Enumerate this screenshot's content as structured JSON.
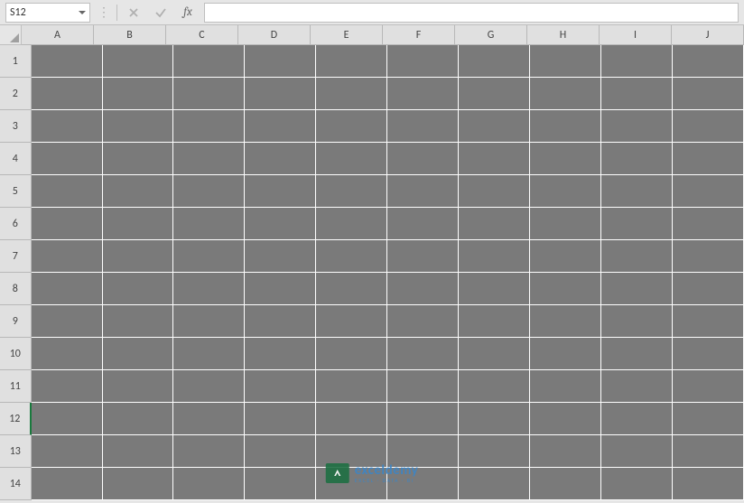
{
  "nameBox": {
    "value": "S12"
  },
  "formulaBar": {
    "value": ""
  },
  "columns": [
    "A",
    "B",
    "C",
    "D",
    "E",
    "F",
    "G",
    "H",
    "I",
    "J"
  ],
  "rows": [
    "1",
    "2",
    "3",
    "4",
    "5",
    "6",
    "7",
    "8",
    "9",
    "10",
    "11",
    "12",
    "13",
    "14"
  ],
  "activeRowIndex": 11,
  "watermark": {
    "main": "exceldemy",
    "sub": "EXCEL · DATA · BI"
  }
}
